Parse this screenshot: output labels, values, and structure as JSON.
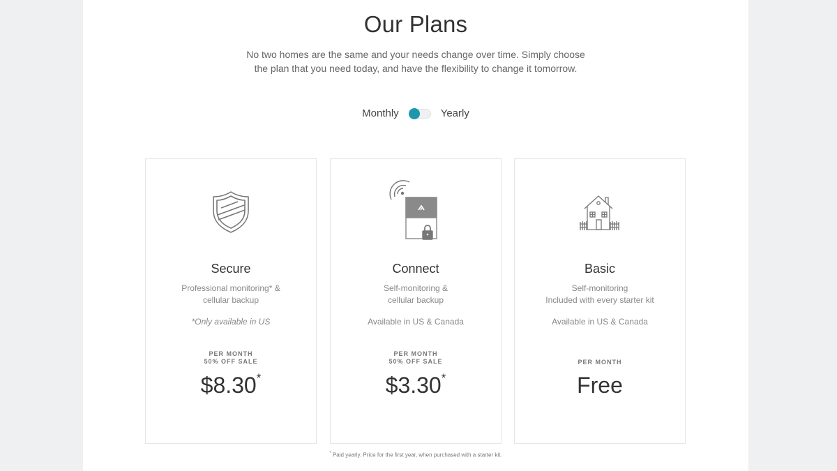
{
  "header": {
    "title": "Our Plans",
    "subtitle_line1": "No two homes are the same and your needs change over time. Simply choose",
    "subtitle_line2": "the plan that you need today, and have the flexibility to change it tomorrow."
  },
  "billing_toggle": {
    "left_label": "Monthly",
    "right_label": "Yearly",
    "selected": "Monthly",
    "accent_color": "#1e97ad"
  },
  "plans": [
    {
      "name": "Secure",
      "icon": "shield-icon",
      "desc_line1": "Professional monitoring* &",
      "desc_line2": "cellular backup",
      "availability": "*Only available in US",
      "per_line1": "PER MONTH",
      "per_line2": "50% OFF SALE",
      "price": "$8.30",
      "price_mark": "*"
    },
    {
      "name": "Connect",
      "icon": "hub-lock-icon",
      "desc_line1": "Self-monitoring &",
      "desc_line2": "cellular backup",
      "availability": "Available in US & Canada",
      "per_line1": "PER MONTH",
      "per_line2": "50% OFF SALE",
      "price": "$3.30",
      "price_mark": "*"
    },
    {
      "name": "Basic",
      "icon": "house-icon",
      "desc_line1": "Self-monitoring",
      "desc_line2": "Included with every starter kit",
      "availability": "Available in US & Canada",
      "per_line1": "PER MONTH",
      "price": "Free"
    }
  ],
  "footnote": {
    "mark": "*",
    "text": " Paid yearly. Price for the first year, when purchased with a starter kit."
  }
}
